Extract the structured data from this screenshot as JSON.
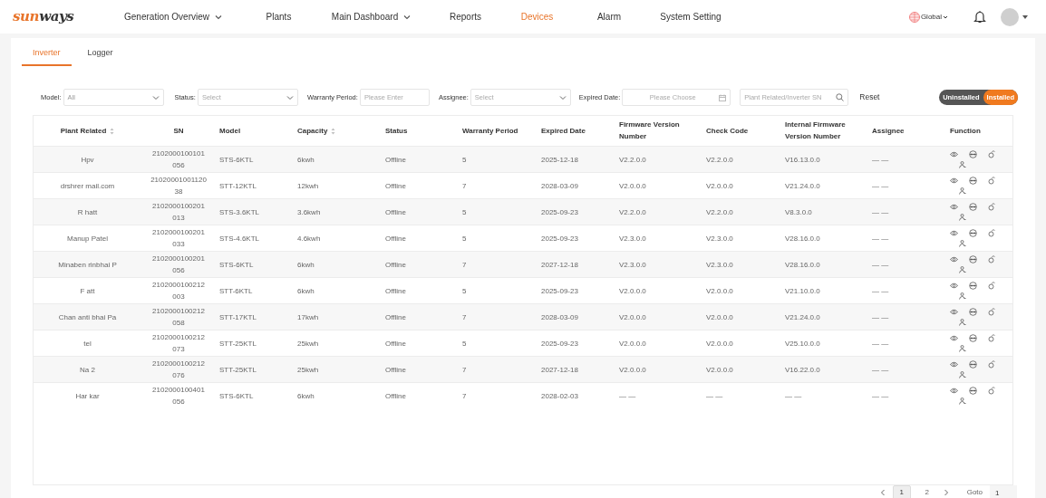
{
  "logo": {
    "accent": "sun",
    "rest": "ways"
  },
  "nav": [
    {
      "label": "Generation Overview",
      "has_menu": true,
      "selected": false
    },
    {
      "label": "Plants",
      "has_menu": false,
      "selected": false
    },
    {
      "label": "Main Dashboard",
      "has_menu": true,
      "selected": false
    },
    {
      "label": "Reports",
      "has_menu": false,
      "selected": false
    },
    {
      "label": "Devices",
      "has_menu": false,
      "selected": true
    },
    {
      "label": "Alarm",
      "has_menu": false,
      "selected": false
    },
    {
      "label": "System Setting",
      "has_menu": false,
      "selected": false
    }
  ],
  "region": {
    "label": "Global"
  },
  "tabs": [
    {
      "label": "Inverter",
      "selected": true
    },
    {
      "label": "Logger",
      "selected": false
    }
  ],
  "filters": [
    {
      "kind": "select",
      "label": "Model:",
      "value": "All"
    },
    {
      "kind": "select",
      "label": "Status:",
      "placeholder": "Select"
    },
    {
      "kind": "input",
      "label": "Warranty Period:",
      "placeholder": "Please Enter"
    },
    {
      "kind": "select",
      "label": "Assignee:",
      "placeholder": "Select"
    },
    {
      "kind": "date",
      "label": "Expired Date:",
      "placeholder": "Please Choose"
    },
    {
      "kind": "search",
      "placeholder": "Plant Related/Inverter SN"
    }
  ],
  "reset": "Reset",
  "install_toggle": [
    {
      "label": "Uninstalled",
      "selected": false
    },
    {
      "label": "Installed",
      "selected": true
    }
  ],
  "table": {
    "columns": [
      {
        "label": "Plant Related",
        "sortable": true
      },
      {
        "label": "SN",
        "sortable": false
      },
      {
        "label": "Model",
        "sortable": false
      },
      {
        "label": "Capacity",
        "sortable": true
      },
      {
        "label": "Status",
        "sortable": false
      },
      {
        "label": "Warranty Period",
        "sortable": false
      },
      {
        "label": "Expired Date",
        "sortable": false
      },
      {
        "label": "Firmware Version Number",
        "sortable": false
      },
      {
        "label": "Check Code",
        "sortable": false
      },
      {
        "label": "Internal Firmware Version Number",
        "sortable": false
      },
      {
        "label": "Assignee",
        "sortable": false
      },
      {
        "label": "Function",
        "sortable": false
      }
    ],
    "rows": [
      {
        "plant": "Hpv",
        "sn": "2102000100101056",
        "model": "STS-6KTL",
        "capacity": "6kwh",
        "status": "Offline",
        "warranty": "5",
        "expired": "2025-12-18",
        "firmware": "V2.2.0.0",
        "check_code": "V2.2.0.0",
        "internal_firmware": "V16.13.0.0",
        "assignee": "— —"
      },
      {
        "plant": "drshrer mail.com",
        "sn": "2102000100112038",
        "model": "STT-12KTL",
        "capacity": "12kwh",
        "status": "Offline",
        "warranty": "7",
        "expired": "2028-03-09",
        "firmware": "V2.0.0.0",
        "check_code": "V2.0.0.0",
        "internal_firmware": "V21.24.0.0",
        "assignee": "— —"
      },
      {
        "plant": "R hatt",
        "sn": "2102000100201013",
        "model": "STS-3.6KTL",
        "capacity": "3.6kwh",
        "status": "Offline",
        "warranty": "5",
        "expired": "2025-09-23",
        "firmware": "V2.2.0.0",
        "check_code": "V2.2.0.0",
        "internal_firmware": "V8.3.0.0",
        "assignee": "— —"
      },
      {
        "plant": "Manup Patel",
        "sn": "2102000100201033",
        "model": "STS-4.6KTL",
        "capacity": "4.6kwh",
        "status": "Offline",
        "warranty": "5",
        "expired": "2025-09-23",
        "firmware": "V2.3.0.0",
        "check_code": "V2.3.0.0",
        "internal_firmware": "V28.16.0.0",
        "assignee": "— —"
      },
      {
        "plant": "Minaben rinbhai P",
        "sn": "2102000100201056",
        "model": "STS-6KTL",
        "capacity": "6kwh",
        "status": "Offline",
        "warranty": "7",
        "expired": "2027-12-18",
        "firmware": "V2.3.0.0",
        "check_code": "V2.3.0.0",
        "internal_firmware": "V28.16.0.0",
        "assignee": "— —"
      },
      {
        "plant": "F att",
        "sn": "2102000100212003",
        "model": "STT-6KTL",
        "capacity": "6kwh",
        "status": "Offline",
        "warranty": "5",
        "expired": "2025-09-23",
        "firmware": "V2.0.0.0",
        "check_code": "V2.0.0.0",
        "internal_firmware": "V21.10.0.0",
        "assignee": "— —"
      },
      {
        "plant": "Chan anti bhai Pa",
        "sn": "2102000100212058",
        "model": "STT-17KTL",
        "capacity": "17kwh",
        "status": "Offline",
        "warranty": "7",
        "expired": "2028-03-09",
        "firmware": "V2.0.0.0",
        "check_code": "V2.0.0.0",
        "internal_firmware": "V21.24.0.0",
        "assignee": "— —"
      },
      {
        "plant": "tel",
        "sn": "2102000100212073",
        "model": "STT-25KTL",
        "capacity": "25kwh",
        "status": "Offline",
        "warranty": "5",
        "expired": "2025-09-23",
        "firmware": "V2.0.0.0",
        "check_code": "V2.0.0.0",
        "internal_firmware": "V25.10.0.0",
        "assignee": "— —"
      },
      {
        "plant": "Na 2",
        "sn": "2102000100212076",
        "model": "STT-25KTL",
        "capacity": "25kwh",
        "status": "Offline",
        "warranty": "7",
        "expired": "2027-12-18",
        "firmware": "V2.0.0.0",
        "check_code": "V2.0.0.0",
        "internal_firmware": "V16.22.0.0",
        "assignee": "— —"
      },
      {
        "plant": "Har kar",
        "sn": "2102000100401056",
        "model": "STS-6KTL",
        "capacity": "6kwh",
        "status": "Offline",
        "warranty": "7",
        "expired": "2028-02-03",
        "firmware": "— —",
        "check_code": "— —",
        "internal_firmware": "— —",
        "assignee": "— —"
      }
    ]
  },
  "pagination": {
    "pages": [
      {
        "label": "1",
        "selected": true
      },
      {
        "label": "2",
        "selected": false
      }
    ],
    "goto_label": "Goto",
    "goto_value": "1"
  }
}
